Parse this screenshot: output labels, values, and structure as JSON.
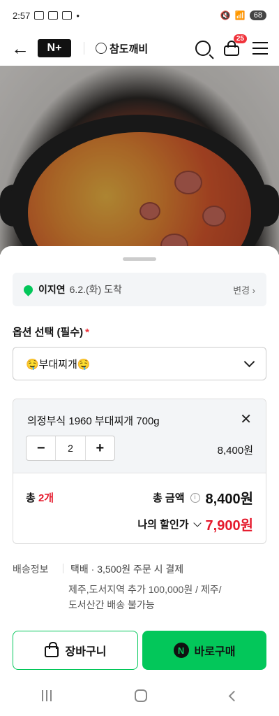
{
  "status_bar": {
    "time": "2:57",
    "battery": "68"
  },
  "app_bar": {
    "logo": "N+",
    "brand": "참도깨비",
    "cart_badge": "25"
  },
  "delivery": {
    "name": "이지연",
    "date": "6.2.(화) 도착",
    "change": "변경 ›"
  },
  "option": {
    "title": "옵션 선택 (필수)",
    "required_mark": "*",
    "selected": "🤤부대찌개🤤"
  },
  "item": {
    "name": "의정부식 1960 부대찌개 700g",
    "qty": "2",
    "price": "8,400원",
    "minus": "−",
    "plus": "+",
    "close": "✕"
  },
  "summary": {
    "total_prefix": "총 ",
    "total_count": "2개",
    "amount_label": "총 금액",
    "amount": "8,400원",
    "discount_label": "나의 할인가",
    "discount": "7,900원",
    "info_icon": "i"
  },
  "shipping": {
    "label": "배송정보",
    "desc": "택배 · 3,500원 주문 시 결제",
    "extra1": "제주,도서지역 추가 100,000원 / 제주/",
    "extra2": "도서산간 배송 불가능"
  },
  "buttons": {
    "cart": "장바구니",
    "buy": "바로구매",
    "buy_icon": "N"
  },
  "colors": {
    "accent": "#03c75a",
    "price_red": "#e5192c"
  }
}
